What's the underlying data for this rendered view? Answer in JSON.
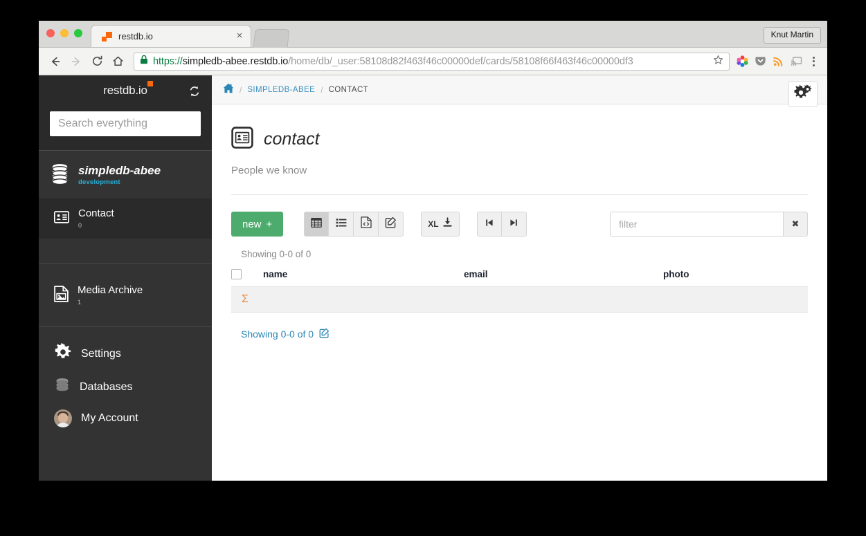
{
  "browser": {
    "tab": {
      "title": "restdb.io",
      "favicon": "restdb-favicon",
      "close": "×"
    },
    "profile_button": "Knut Martin",
    "url": {
      "scheme": "https://",
      "host": "simpledb-abee.restdb.io",
      "path": "/home/db/_user:58108d82f463f46c00000def/cards/58108f66f463f46c00000df3",
      "full": "https://simpledb-abee.restdb.io/home/db/_user:58108d82f463f46c00000def/cards/58108f66f463f46c00000df3"
    },
    "nav_icons": [
      "back-icon",
      "forward-icon",
      "reload-icon",
      "home-icon"
    ],
    "extension_icons": [
      "colorwheel-icon",
      "pocket-icon",
      "rss-icon",
      "cast-icon",
      "kebab-menu-icon"
    ]
  },
  "sidebar": {
    "logo": "restdb.io",
    "refresh_icon": "refresh-icon",
    "search": {
      "value": "",
      "placeholder": "Search everything"
    },
    "database": {
      "name": "simpledb-abee",
      "env": "development",
      "icon": "database-icon"
    },
    "collections": [
      {
        "label": "Contact",
        "count": "0",
        "icon": "vcard-icon",
        "active": true
      },
      {
        "label": "Media Archive",
        "count": "1",
        "icon": "image-file-icon",
        "active": false
      }
    ],
    "footer_items": [
      {
        "label": "Settings",
        "icon": "gear-icon"
      },
      {
        "label": "Databases",
        "icon": "database-icon"
      },
      {
        "label": "My Account",
        "icon": "avatar"
      }
    ]
  },
  "main": {
    "breadcrumb": {
      "home_icon": "home-icon",
      "separator": "/",
      "database": "SIMPLEDB-ABEE",
      "current": "CONTACT"
    },
    "settings_button_icon": "gears-icon",
    "collection": {
      "icon": "vcard-icon",
      "title": "contact",
      "description": "People we know"
    },
    "toolbar": {
      "new_label": "new",
      "new_plus": "+",
      "view_buttons": [
        {
          "name": "grid-view",
          "icon": "table-icon",
          "active": true
        },
        {
          "name": "list-view",
          "icon": "list-icon",
          "active": false
        },
        {
          "name": "json-view",
          "icon": "code-file-icon",
          "active": false
        },
        {
          "name": "form-edit-view",
          "icon": "edit-square-icon",
          "active": false
        }
      ],
      "export_label": "XL",
      "export_icon": "download-icon",
      "pager": [
        {
          "name": "first-page",
          "icon": "step-backward-icon"
        },
        {
          "name": "last-page",
          "icon": "step-forward-icon"
        }
      ],
      "filter": {
        "value": "",
        "placeholder": "filter"
      },
      "filter_clear_icon": "clear-icon"
    },
    "table": {
      "showing_top": "Showing 0-0 of 0",
      "columns": [
        "name",
        "email",
        "photo"
      ],
      "rows": [],
      "sum_symbol": "Σ",
      "showing_bottom": "Showing 0-0 of 0",
      "showing_bottom_icon": "edit-square-icon"
    }
  },
  "colors": {
    "sidebar_bg": "#333333",
    "sidebar_top_bg": "#2a2a2a",
    "accent_orange": "#f96a0d",
    "accent_green": "#4cab6d",
    "link_blue": "#2b86b5",
    "env_cyan": "#2ab0d8",
    "sigma_orange": "#e8873a"
  }
}
